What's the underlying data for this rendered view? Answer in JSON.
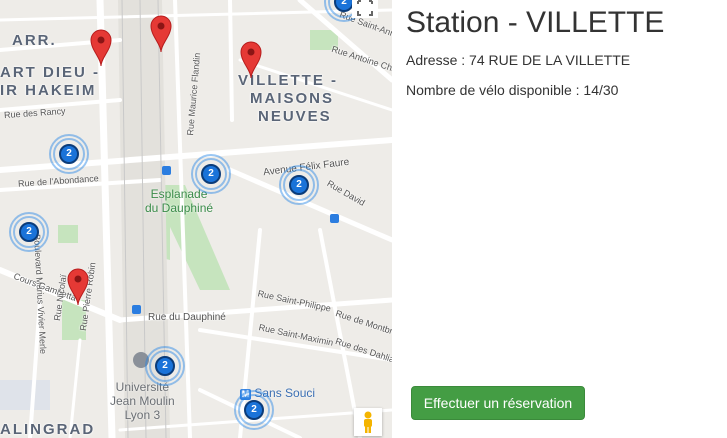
{
  "station": {
    "title": "Station - VILLETTE",
    "address_label": "Adresse : 74 RUE DE LA VILLETTE",
    "bikes_label": "Nombre de vélo disponible : 14/30"
  },
  "reserve_button": {
    "label": "Effectuer un réservation",
    "color": "#449d44"
  },
  "map": {
    "districts": [
      "ARR.",
      "ART DIEU -",
      "IR HAKEIM",
      "VILLETTE -",
      "MAISONS",
      "NEUVES",
      "ALINGRAD"
    ],
    "streets": [
      "Rue des Rancy",
      "Rue de l'Abondance",
      "Boulevard Marius Vivier Merle",
      "Rue Maurice Flandin",
      "Avenue Félix Faure",
      "Rue David",
      "Rue Antoine Charial",
      "Rue Saint-Anne",
      "Cours Gambetta",
      "Rue Nicolaï",
      "Rue Pierre Robin",
      "Rue du Dauphiné",
      "Rue Saint-Philippe",
      "Rue Saint-Maximin",
      "Rue de Montbrillant",
      "Rue des Dahlias"
    ],
    "pois": {
      "park": [
        "Esplanade",
        "du Dauphiné"
      ],
      "university": [
        "Université",
        "Jean Moulin",
        "Lyon 3"
      ],
      "metro": "Sans Souci"
    },
    "clusters": [
      "2",
      "2",
      "2",
      "2",
      "2",
      "2",
      "2"
    ],
    "marker_color": "#e53935",
    "cluster_color": "#1a73d9",
    "icons": [
      "fullscreen-icon",
      "pegman-icon",
      "map-marker-icon",
      "metro-icon",
      "tram-icon"
    ]
  }
}
